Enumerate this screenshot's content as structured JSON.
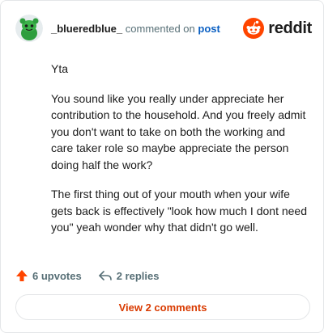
{
  "header": {
    "username": "_blueredblue_",
    "commented_text": "commented on",
    "post_link": "post",
    "brand": "reddit"
  },
  "comment": {
    "paragraphs": [
      "Yta",
      "You sound like you really under appreciate her contribution to the household. And you freely admit you don't want to take on both the working and care taker role so maybe appreciate the person doing half the work?",
      "The first thing out of your mouth when your wife gets back is effectively \"look how much I dont need you\" yeah wonder why that didn't go well."
    ]
  },
  "actions": {
    "upvotes": "6 upvotes",
    "replies": "2 replies"
  },
  "view_comments_label": "View 2 comments",
  "colors": {
    "upvote": "#ff4500",
    "brand": "#ff4500",
    "link": "#0a5fc2",
    "view_button_text": "#d93a00"
  },
  "icons": {
    "avatar": "green-snoo-avatar",
    "brand": "reddit-logo-icon",
    "upvote": "upvote-arrow-icon",
    "reply": "reply-arrow-icon"
  }
}
